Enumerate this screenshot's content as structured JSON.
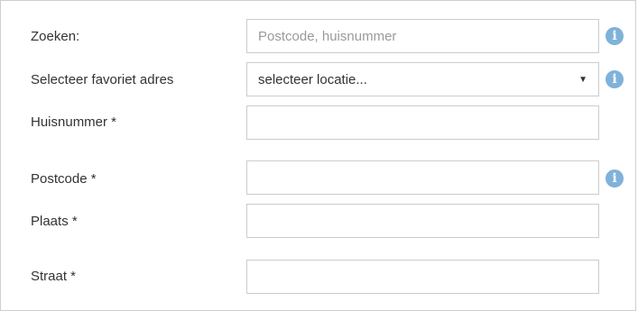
{
  "form": {
    "search": {
      "label": "Zoeken:",
      "placeholder": "Postcode, huisnummer",
      "value": ""
    },
    "favorite": {
      "label": "Selecteer favoriet adres",
      "selected": "selecteer locatie...",
      "caret": "▼"
    },
    "house_number": {
      "label": "Huisnummer *",
      "value": ""
    },
    "postcode": {
      "label": "Postcode *",
      "value": ""
    },
    "city": {
      "label": "Plaats *",
      "value": ""
    },
    "street": {
      "label": "Straat *",
      "value": ""
    }
  },
  "icons": {
    "info_glyph": "i",
    "info_color": "#7fb2d9"
  }
}
